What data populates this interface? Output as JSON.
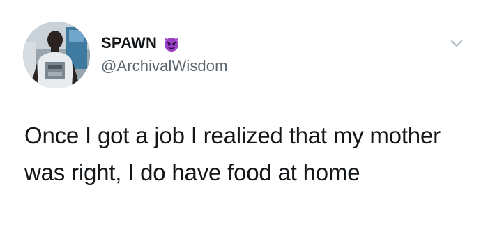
{
  "tweet": {
    "author": {
      "display_name": "SPAWN",
      "name_emoji_icon": "smiling-devil-icon",
      "handle": "@ArchivalWisdom",
      "avatar_icon": "profile-photo"
    },
    "menu_icon": "chevron-down-icon",
    "text": "Once I got a job I realized that my mother was right, I do have food at home"
  },
  "colors": {
    "text": "#14171a",
    "handle": "#5b6770",
    "devil_purple": "#9b3fc6",
    "chevron": "#aab8c2"
  }
}
